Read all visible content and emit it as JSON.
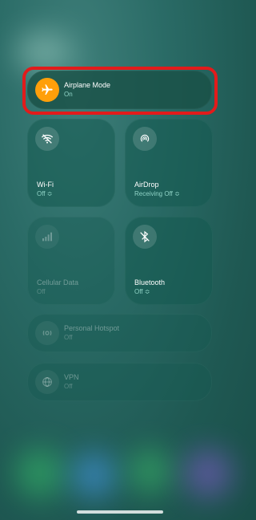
{
  "airplane": {
    "label": "Airplane Mode",
    "status": "On",
    "accent": "#ff9f0a"
  },
  "wifi": {
    "label": "Wi-Fi",
    "status": "Off ≎"
  },
  "airdrop": {
    "label": "AirDrop",
    "status": "Receiving Off ≎"
  },
  "cellular": {
    "label": "Cellular Data",
    "status": "Off"
  },
  "bluetooth": {
    "label": "Bluetooth",
    "status": "Off ≎"
  },
  "hotspot": {
    "label": "Personal Hotspot",
    "status": "Off"
  },
  "vpn": {
    "label": "VPN",
    "status": "Off"
  },
  "highlight_color": "#e21b1b"
}
